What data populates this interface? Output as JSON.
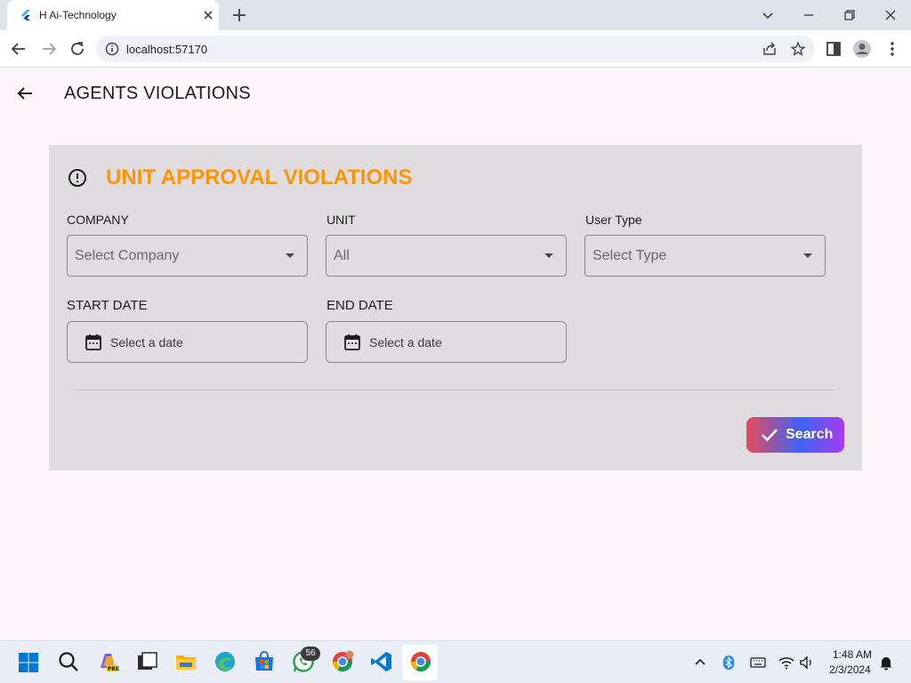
{
  "browser": {
    "tab_title": "H Ai-Technology",
    "url": "localhost:57170"
  },
  "app": {
    "title": "AGENTS VIOLATIONS"
  },
  "card": {
    "title": "UNIT APPROVAL VIOLATIONS",
    "accent_color": "#ff9500",
    "fields": {
      "company_label": "COMPANY",
      "company_value": "Select Company",
      "unit_label": "UNIT",
      "unit_value": "All",
      "user_type_label": "User Type",
      "user_type_value": "Select Type",
      "start_date_label": "START DATE",
      "start_date_value": "Select a date",
      "end_date_label": "END DATE",
      "end_date_value": "Select a date"
    },
    "search_label": "Search"
  },
  "taskbar": {
    "whatsapp_badge": "56",
    "time": "1:48 AM",
    "date": "2/3/2024"
  }
}
